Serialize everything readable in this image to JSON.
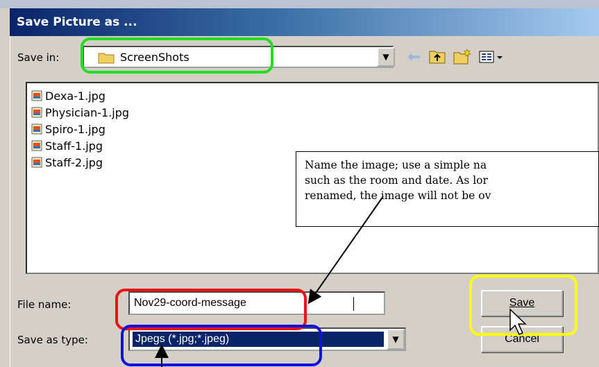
{
  "window": {
    "title": "Save Picture as ..."
  },
  "save_in": {
    "label": "Save in:",
    "value": "ScreenShots"
  },
  "toolbar": {
    "back_icon": "back-arrow-icon",
    "up_icon": "up-folder-icon",
    "new_folder_icon": "new-folder-icon",
    "view_icon": "view-menu-icon"
  },
  "files": [
    {
      "name": "Dexa-1.jpg"
    },
    {
      "name": "Physician-1.jpg"
    },
    {
      "name": "Spiro-1.jpg"
    },
    {
      "name": "Staff-1.jpg"
    },
    {
      "name": "Staff-2.jpg"
    }
  ],
  "file_name": {
    "label": "File name:",
    "value": "Nov29-coord-message"
  },
  "save_as_type": {
    "label": "Save as type:",
    "value": "Jpegs (*.jpg;*.jpeg)"
  },
  "buttons": {
    "save": "Save",
    "cancel": "Cancel"
  },
  "annotation": {
    "line1": "Name the image; use a simple na",
    "line2": "such as the room and date. As lor",
    "line3": "renamed, the image will not be ov"
  },
  "highlight_colors": {
    "green": "#22dd22",
    "red": "#ee1111",
    "blue": "#1111dd",
    "yellow": "#ffff00"
  }
}
